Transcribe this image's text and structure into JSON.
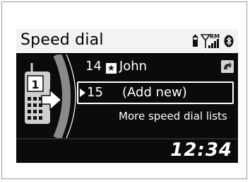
{
  "header": {
    "title": "Speed dial",
    "status": {
      "roaming": "RM",
      "icons": [
        "phone-battery-icon",
        "signal-strength-icon",
        "bluetooth-icon"
      ]
    }
  },
  "list": {
    "entry": {
      "number": "14",
      "name": "John",
      "favorite_icon": "star-icon",
      "voice_tag_icon": "voice-tag-icon"
    },
    "selected": {
      "number": "15",
      "label": "(Add new)"
    },
    "more": "More speed dial lists"
  },
  "sidebar": {
    "phone_icon": "phone-with-speed-dial-icon",
    "slot": "1"
  },
  "clock": "12:34",
  "colors": {
    "header_bg": "#f3f3f3",
    "screen_bg": "#0b0b0b",
    "text": "#ffffff",
    "accent_gray": "#8a8a8a"
  }
}
